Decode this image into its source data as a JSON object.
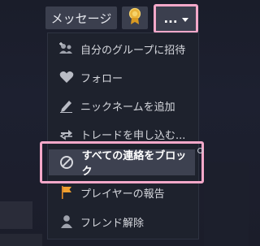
{
  "toolbar": {
    "message_label": "メッセージ",
    "more_label": "..."
  },
  "menu": {
    "items": [
      {
        "label": "自分のグループに招待",
        "icon": "invite-group-icon"
      },
      {
        "label": "フォロー",
        "icon": "heart-follow-icon"
      },
      {
        "label": "ニックネームを追加",
        "icon": "pencil-icon"
      },
      {
        "label": "トレードを申し込む...",
        "icon": "trade-arrows-icon"
      },
      {
        "label": "すべての連絡をブロック",
        "icon": "block-icon"
      },
      {
        "label": "プレイヤーの報告",
        "icon": "flag-icon"
      },
      {
        "label": "フレンド解除",
        "icon": "remove-friend-icon"
      }
    ]
  },
  "colors": {
    "highlight_outline": "#f4a8c9",
    "menu_bg": "#1e222d",
    "selected_item_bg": "#3d4150"
  }
}
